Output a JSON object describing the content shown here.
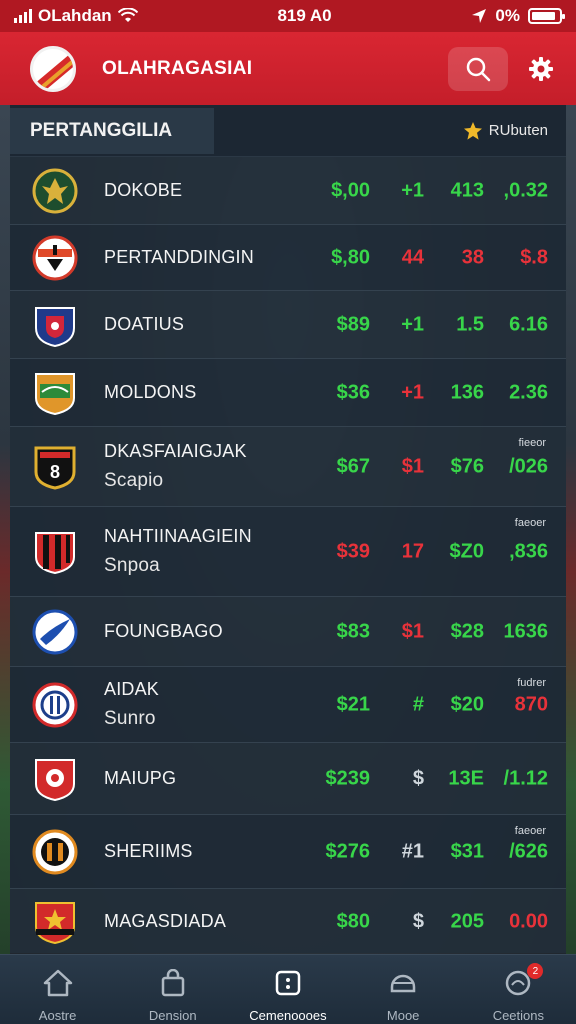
{
  "status_bar": {
    "carrier": "OLahdan",
    "time": "819 A0",
    "battery": "0%",
    "battery_level": 0.9
  },
  "header": {
    "title": "OLAHRAGASIAI"
  },
  "panel": {
    "tab_label": "PERTANGGILIA",
    "action_label": "RUbuten"
  },
  "rows": [
    {
      "name": "DOKOBE",
      "sub": "",
      "tiny": "",
      "v1": "$,00",
      "v2": "+1",
      "v3": "413",
      "v4": ",0.32",
      "colors": [
        "green",
        "green",
        "green",
        "green"
      ],
      "badge": "eagle-crest-icon"
    },
    {
      "name": "PERTANDDINGIN",
      "sub": "",
      "tiny": "",
      "v1": "$,80",
      "v2": "44",
      "v3": "38",
      "v4": "$.8",
      "colors": [
        "green",
        "red",
        "red",
        "red"
      ],
      "badge": "red-black-crest-icon"
    },
    {
      "name": "DOATIUS",
      "sub": "",
      "tiny": "",
      "v1": "$89",
      "v2": "+1",
      "v3": "1.5",
      "v4": "6.16",
      "colors": [
        "green",
        "green",
        "green",
        "green"
      ],
      "badge": "blue-red-shield-icon"
    },
    {
      "name": "MOLDONS",
      "sub": "",
      "tiny": "",
      "v1": "$36",
      "v2": "+1",
      "v3": "136",
      "v4": "2.36",
      "colors": [
        "green",
        "red",
        "green",
        "green"
      ],
      "badge": "orange-green-shield-icon"
    },
    {
      "name": "DKASFAIAIGJAK",
      "sub": "Scapio",
      "tiny": "fieeor",
      "v1": "$67",
      "v2": "$1",
      "v3": "$76",
      "v4": "/026",
      "colors": [
        "green",
        "red",
        "green",
        "green"
      ],
      "badge": "black-number-8-shield-icon"
    },
    {
      "name": "NAHTIINAAGIEIN",
      "sub": "Snpoa",
      "tiny": "faeoer",
      "v1": "$39",
      "v2": "17",
      "v3": "$Z0",
      "v4": ",836",
      "colors": [
        "red",
        "red",
        "green",
        "green"
      ],
      "badge": "red-black-stripes-shield-icon"
    },
    {
      "name": "FOUNGBAGO",
      "sub": "",
      "tiny": "",
      "v1": "$83",
      "v2": "$1",
      "v3": "$28",
      "v4": "1636",
      "colors": [
        "green",
        "red",
        "green",
        "green"
      ],
      "badge": "blue-white-wave-crest-icon"
    },
    {
      "name": "AIDAK",
      "sub": "Sunro",
      "tiny": "fudrer",
      "v1": "$21",
      "v2": "#",
      "v3": "$20",
      "v4": "870",
      "colors": [
        "green",
        "green",
        "green",
        "red"
      ],
      "badge": "red-blue-ring-crest-icon"
    },
    {
      "name": "MAIUPG",
      "sub": "",
      "tiny": "",
      "v1": "$239",
      "v2": "$",
      "v3": "13E",
      "v4": "/1.12",
      "colors": [
        "green",
        "grey",
        "green",
        "green"
      ],
      "badge": "red-white-shield-icon"
    },
    {
      "name": "SHERIIMS",
      "sub": "",
      "tiny": "faeoer",
      "v1": "$276",
      "v2": "#1",
      "v3": "$31",
      "v4": "/626",
      "colors": [
        "green",
        "grey",
        "green",
        "green"
      ],
      "badge": "orange-black-crest-icon"
    },
    {
      "name": "MAGASDIADA",
      "sub": "",
      "tiny": "",
      "v1": "$80",
      "v2": "$",
      "v3": "205",
      "v4": "0.00",
      "colors": [
        "green",
        "grey",
        "green",
        "red"
      ],
      "badge": "red-yellow-star-shield-icon"
    }
  ],
  "bottom_nav": [
    {
      "label": "Aostre",
      "icon": "home-icon",
      "active": false
    },
    {
      "label": "Dension",
      "icon": "shopping-bag-icon",
      "active": false
    },
    {
      "label": "Cemenoooes",
      "icon": "dice-icon",
      "active": true
    },
    {
      "label": "Mooe",
      "icon": "helmet-icon",
      "active": false
    },
    {
      "label": "Ceetions",
      "icon": "chat-icon",
      "active": false,
      "badge": "2"
    }
  ],
  "colors": {
    "header_red": "#d92632",
    "positive": "#38d64a",
    "negative": "#e8323a"
  }
}
